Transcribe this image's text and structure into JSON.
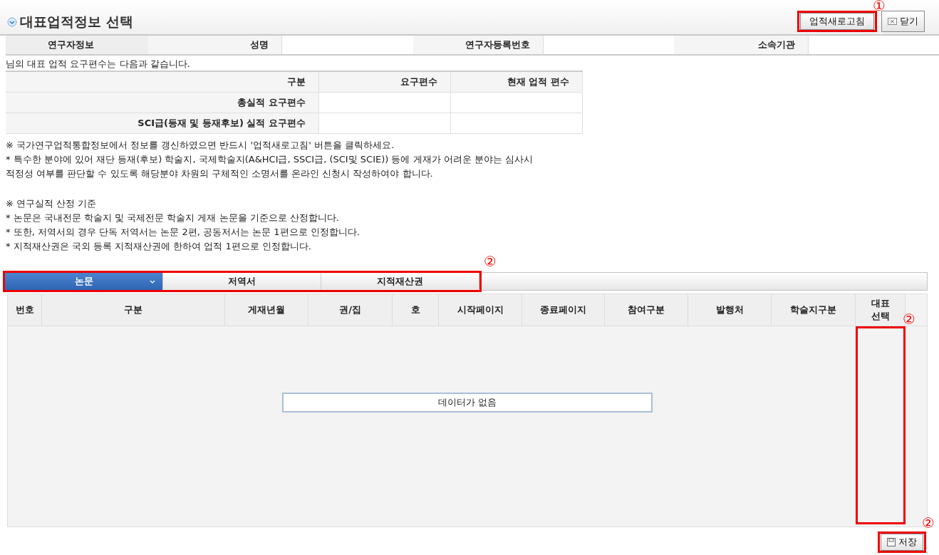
{
  "window": {
    "title": "대표업적정보 선택"
  },
  "header_buttons": [
    {
      "label": "업적새로고침",
      "kind": "text"
    },
    {
      "label": "닫기",
      "kind": "close"
    }
  ],
  "researcher_info": {
    "heading": "연구자정보",
    "fields": [
      {
        "label": "성명"
      },
      {
        "label": "연구자등록번호"
      },
      {
        "label": "소속기관"
      }
    ]
  },
  "intro": "님의 대표 업적 요구편수는 다음과 같습니다.",
  "requirement_table": {
    "columns": [
      "구분",
      "요구편수",
      "현재 업적 편수"
    ],
    "rows": [
      "총실적 요구편수",
      "SCI급(등재 및 등재후보) 실적 요구편수"
    ]
  },
  "notice_lines": [
    "※ 국가연구업적통합정보에서 정보를 갱신하였으면 반드시 '업적새로고침' 버튼을 클릭하세요.",
    "* 특수한 분야에 있어 재단 등재(후보) 학술지, 국제학술지(A&HCI급, SSCI급, (SCI및 SCIE)) 등에 게재가 어려운 분야는 심사시",
    "적정성 여부를 판단할 수 있도록 해당분야 차원의 구체적인 소명서를 온라인 신청시 작성하여야 합니다."
  ],
  "criteria_lines": [
    "※ 연구실적 산정 기준",
    "* 논문은 국내전문 학술지 및 국제전문 학술지 게재 논문을 기준으로 산정합니다.",
    "* 또한, 저역서의 경우 단독 저역서는 논문 2편, 공동저서는 논문 1편으로 인정합니다.",
    "* 지적재산권은 국외 등록 지적재산권에 한하여 업적 1편으로 인정합니다."
  ],
  "tabs": [
    {
      "label": "논문",
      "selected": true
    },
    {
      "label": "저역서",
      "selected": false
    },
    {
      "label": "지적재산권",
      "selected": false
    }
  ],
  "grid": {
    "columns": [
      "번호",
      "구분",
      "게재년월",
      "권/집",
      "호",
      "시작페이지",
      "종료페이지",
      "참여구분",
      "발행처",
      "학술지구분",
      "대표 선택"
    ],
    "empty_message": "데이터가 없음"
  },
  "footer_buttons": [
    {
      "label": "저장",
      "kind": "save"
    }
  ],
  "annotations": [
    {
      "label": "①"
    },
    {
      "label": "②"
    },
    {
      "label": "②"
    },
    {
      "label": "②"
    }
  ]
}
